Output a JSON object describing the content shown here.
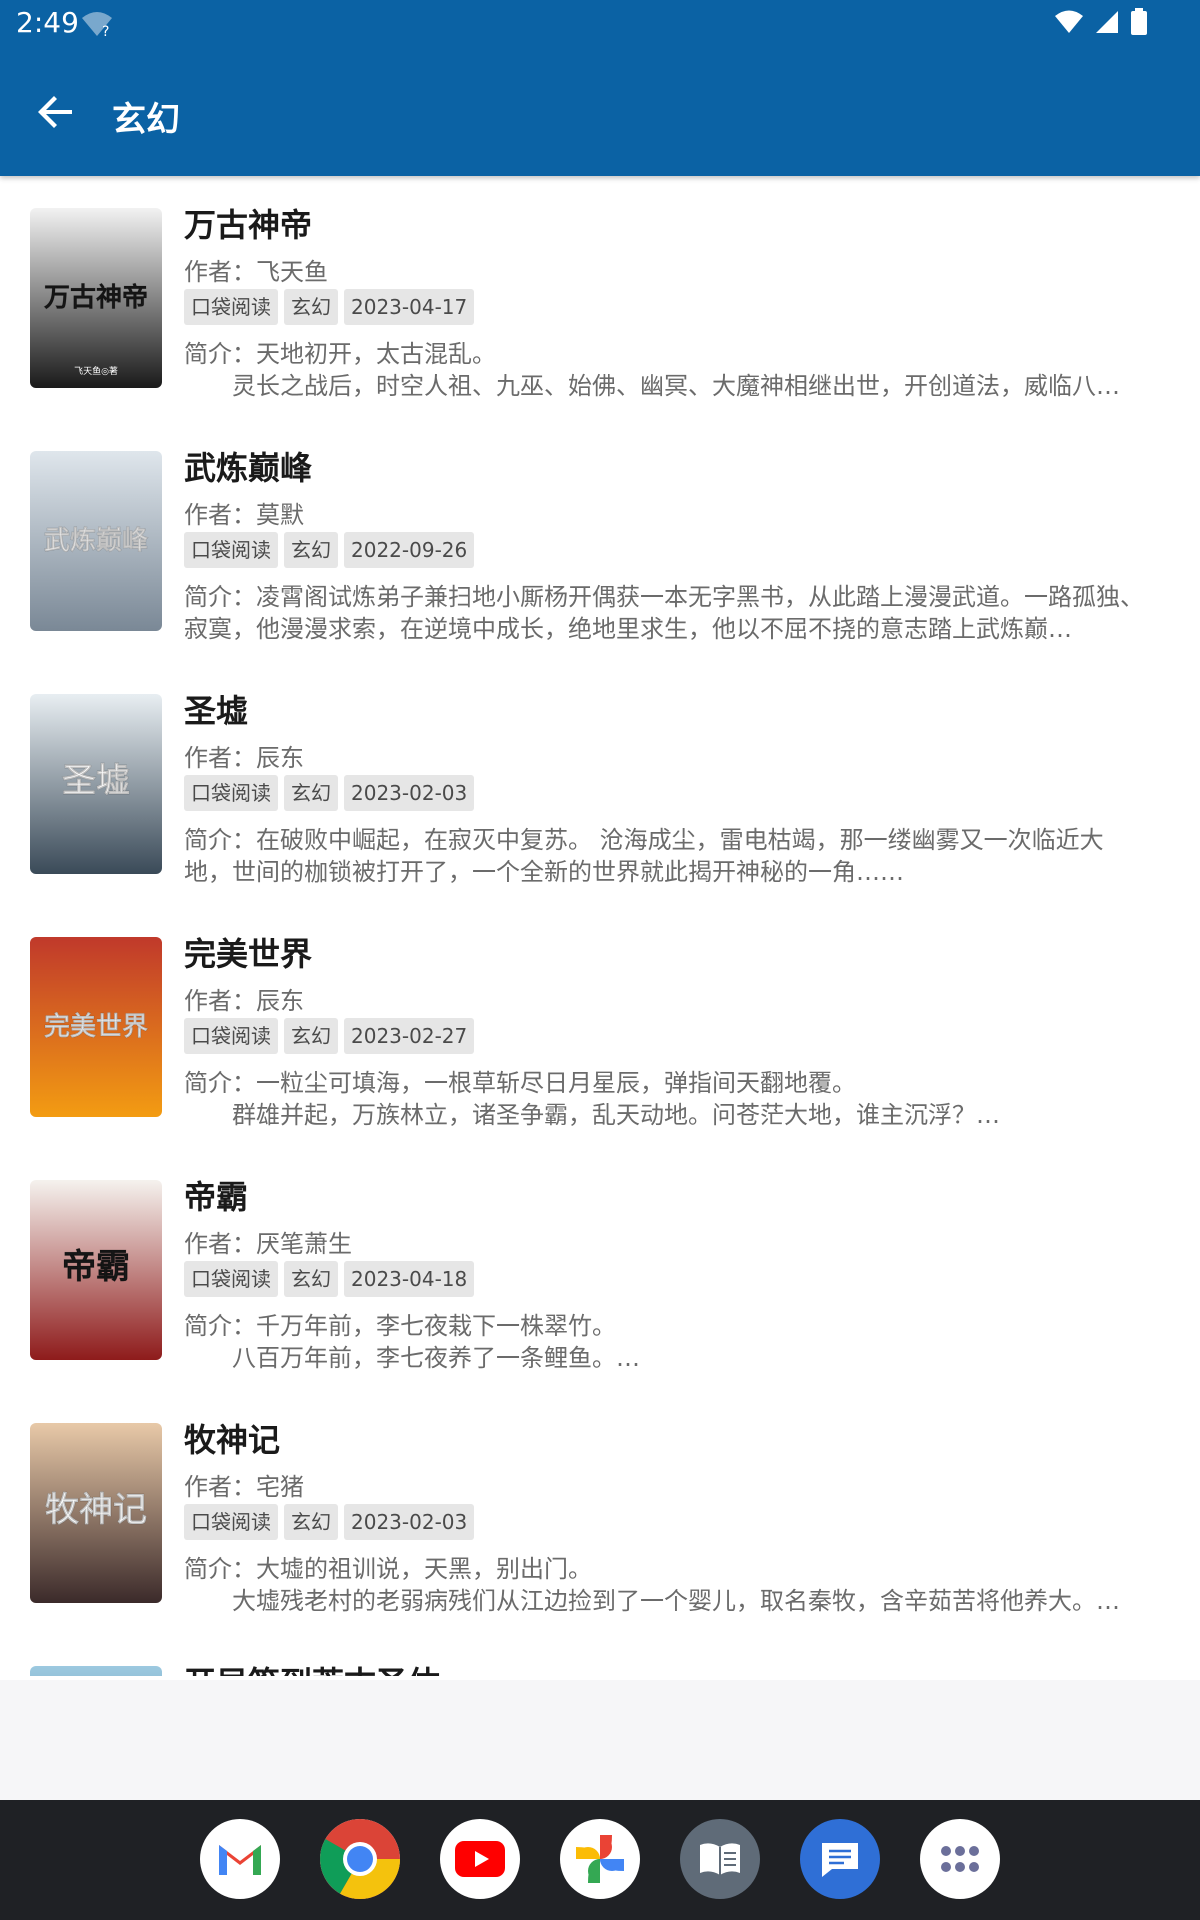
{
  "status_bar": {
    "time": "2:49",
    "wifi_question": "?"
  },
  "app_bar": {
    "title": "玄幻"
  },
  "books": [
    {
      "title": "万古神帝",
      "author": "作者：飞天鱼",
      "tags": [
        "口袋阅读",
        "玄幻",
        "2023-04-17"
      ],
      "intro": "简介：天地初开，太古混乱。\n　　灵长之战后，时空人祖、九巫、始佛、幽冥、大魔神相继出世，开创道法，威临八…",
      "cover_text": "万古神帝",
      "cover_sub": "飞天鱼◎著",
      "cover_colors": [
        "#f2f2f2",
        "#1a1a1a"
      ]
    },
    {
      "title": "武炼巅峰",
      "author": "作者：莫默",
      "tags": [
        "口袋阅读",
        "玄幻",
        "2022-09-26"
      ],
      "intro": "简介：凌霄阁试炼弟子兼扫地小厮杨开偶获一本无字黑书，从此踏上漫漫武道。一路孤独、寂寞，他漫漫求索，在逆境中成长，绝地里求生，他以不屈不挠的意志踏上武炼巅…",
      "cover_text": "武炼巅峰",
      "cover_sub": "",
      "cover_colors": [
        "#dfe6ec",
        "#7a8896"
      ]
    },
    {
      "title": "圣墟",
      "author": "作者：辰东",
      "tags": [
        "口袋阅读",
        "玄幻",
        "2023-02-03"
      ],
      "intro": "简介：在破败中崛起，在寂灭中复苏。 沧海成尘，雷电枯竭，那一缕幽雾又一次临近大地，世间的枷锁被打开了，一个全新的世界就此揭开神秘的一角……",
      "cover_text": "圣墟",
      "cover_sub": "",
      "cover_colors": [
        "#e8eef2",
        "#3a4a58"
      ]
    },
    {
      "title": "完美世界",
      "author": "作者：辰东",
      "tags": [
        "口袋阅读",
        "玄幻",
        "2023-02-27"
      ],
      "intro": "简介：一粒尘可填海，一根草斩尽日月星辰，弹指间天翻地覆。\n　　群雄并起，万族林立，诸圣争霸，乱天动地。问苍茫大地，谁主沉浮？…",
      "cover_text": "完美世界",
      "cover_sub": "",
      "cover_colors": [
        "#c0392b",
        "#f39c12"
      ]
    },
    {
      "title": "帝霸",
      "author": "作者：厌笔萧生",
      "tags": [
        "口袋阅读",
        "玄幻",
        "2023-04-18"
      ],
      "intro": "简介：千万年前，李七夜栽下一株翠竹。\n　　八百万年前，李七夜养了一条鲤鱼。…",
      "cover_text": "帝霸",
      "cover_sub": "",
      "cover_colors": [
        "#f5f2ee",
        "#8e1b1b"
      ]
    },
    {
      "title": "牧神记",
      "author": "作者：宅猪",
      "tags": [
        "口袋阅读",
        "玄幻",
        "2023-02-03"
      ],
      "intro": "简介：大墟的祖训说，天黑，别出门。\n　　大墟残老村的老弱病残们从江边捡到了一个婴儿，取名秦牧，含辛茹苦将他养大。…",
      "cover_text": "牧神记",
      "cover_sub": "",
      "cover_colors": [
        "#e8c9a8",
        "#3b2a2a"
      ]
    },
    {
      "title": "开局签到荒古圣体",
      "author": "",
      "tags": [],
      "intro": "",
      "cover_text": "",
      "cover_sub": "",
      "cover_colors": [
        "#9cc9e0",
        "#2c5a7a"
      ]
    }
  ],
  "dock": [
    {
      "name": "gmail-icon",
      "bg": "#ffffff"
    },
    {
      "name": "chrome-icon",
      "bg": "#ffffff"
    },
    {
      "name": "youtube-icon",
      "bg": "#ffffff"
    },
    {
      "name": "photos-icon",
      "bg": "#ffffff"
    },
    {
      "name": "reader-app-icon",
      "bg": "#5f6b78"
    },
    {
      "name": "messages-icon",
      "bg": "#2f6fd6"
    },
    {
      "name": "app-drawer-icon",
      "bg": "#ffffff"
    }
  ]
}
